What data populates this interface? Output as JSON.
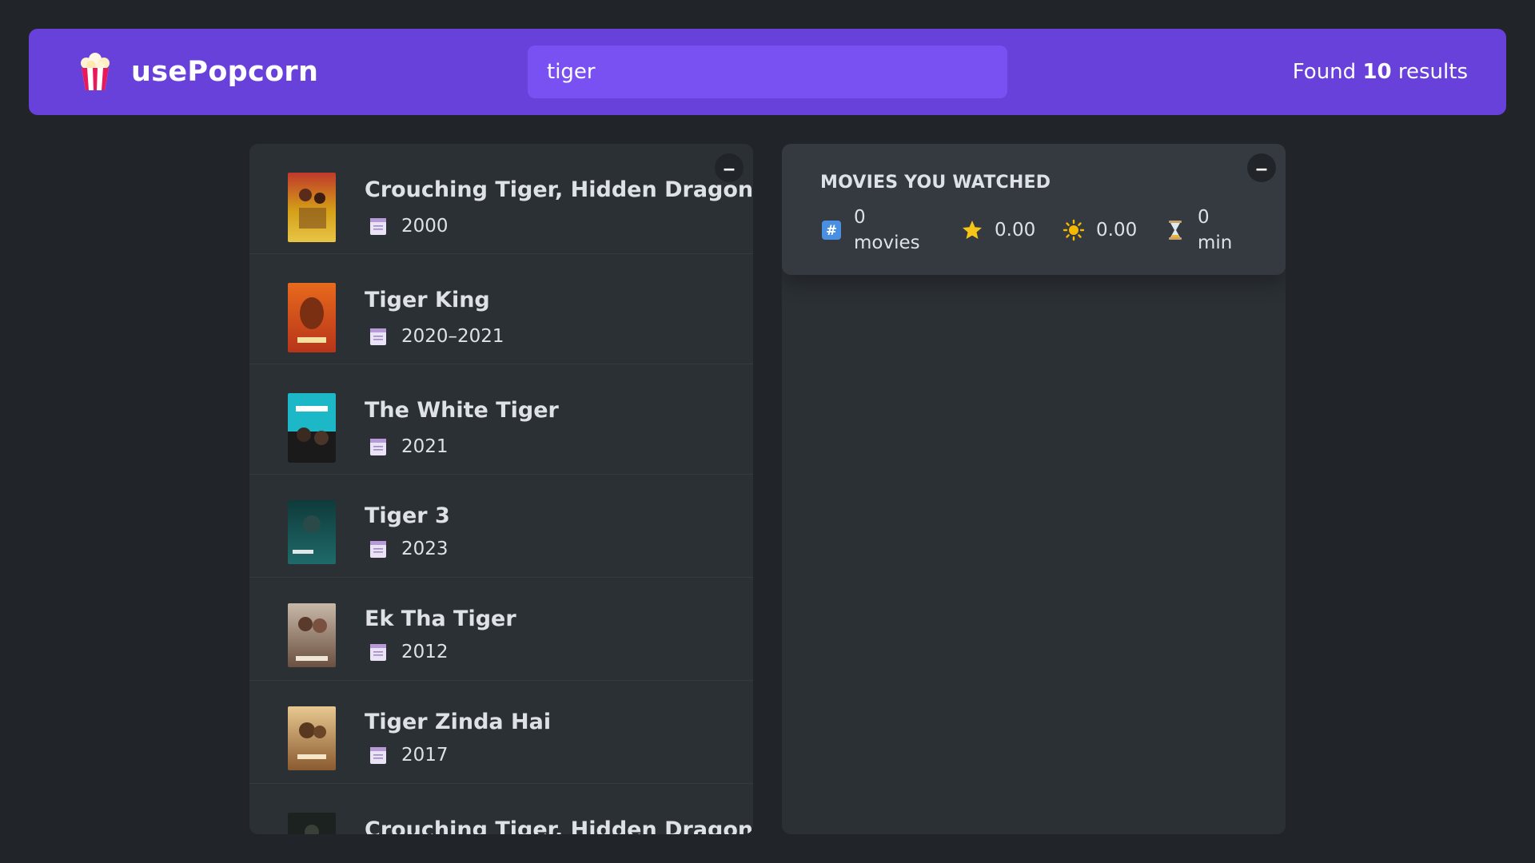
{
  "app": {
    "name": "usePopcorn"
  },
  "search": {
    "value": "tiger"
  },
  "results": {
    "prefix": "Found",
    "count": "10",
    "suffix": "results"
  },
  "movies": [
    {
      "title": "Crouching Tiger, Hidden Dragon",
      "year": "2000"
    },
    {
      "title": "Tiger King",
      "year": "2020–2021"
    },
    {
      "title": "The White Tiger",
      "year": "2021"
    },
    {
      "title": "Tiger 3",
      "year": "2023"
    },
    {
      "title": "Ek Tha Tiger",
      "year": "2012"
    },
    {
      "title": "Tiger Zinda Hai",
      "year": "2017"
    },
    {
      "title": "Crouching Tiger, Hidden Dragon:",
      "year": ""
    }
  ],
  "toggle_label": "–",
  "summary": {
    "heading": "Movies you watched",
    "movies_count": "0",
    "movies_unit": "movies",
    "imdb_rating": "0.00",
    "user_rating": "0.00",
    "runtime": "0",
    "runtime_unit": "min"
  },
  "colors": {
    "primary": "#6741d9",
    "primary_light": "#7950f2",
    "background": "#212529",
    "box": "#2b3035"
  }
}
